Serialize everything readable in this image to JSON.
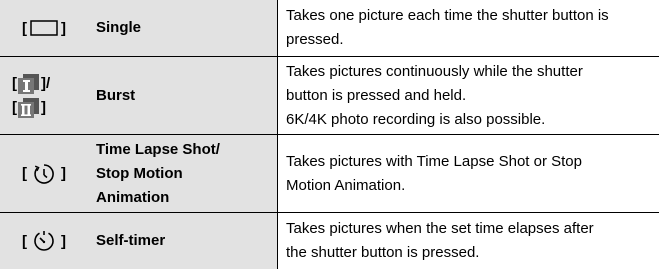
{
  "rows": [
    {
      "icon": "single-frame-icon",
      "icon_open": "[",
      "icon_close": "]",
      "name": "Single",
      "desc_lines": [
        "Takes one picture each time the shutter button is",
        "pressed."
      ]
    },
    {
      "icon": "burst-icon",
      "icon_open": "[",
      "icon_close_1": "]/",
      "icon_open_2": "[",
      "icon_close_2": "]",
      "name": "Burst",
      "desc_lines": [
        "Takes pictures continuously while the shutter",
        "button is pressed and held.",
        "6K/4K photo recording is also possible."
      ]
    },
    {
      "icon": "time-lapse-icon",
      "icon_open": "[",
      "icon_close": "]",
      "name_lines": [
        "Time Lapse Shot/",
        "Stop Motion",
        "Animation"
      ],
      "desc_lines": [
        "Takes pictures with Time Lapse Shot or Stop",
        "Motion Animation."
      ]
    },
    {
      "icon": "self-timer-icon",
      "icon_open": "[",
      "icon_close": "]",
      "name": "Self-timer",
      "desc_lines": [
        "Takes pictures when the set time elapses after",
        "the shutter button is pressed."
      ]
    }
  ],
  "colors": {
    "left_bg": "#e2e2e2",
    "line": "#000000",
    "icon_fill": "#555555"
  }
}
